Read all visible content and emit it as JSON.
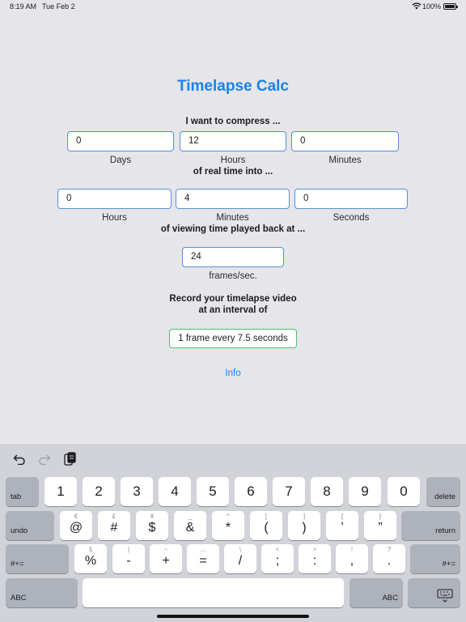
{
  "status_bar": {
    "time": "8:19 AM",
    "date": "Tue Feb 2",
    "battery_percent": "100%",
    "battery_level": 1.0
  },
  "app": {
    "title": "Timelapse Calc",
    "compress_heading": "I want to compress ...",
    "real_time": {
      "days": "0",
      "hours": "12",
      "minutes": "0",
      "days_label": "Days",
      "hours_label": "Hours",
      "minutes_label": "Minutes"
    },
    "into_heading": "of real time into ...",
    "viewing_time": {
      "hours": "0",
      "minutes": "4",
      "seconds": "0",
      "hours_label": "Hours",
      "minutes_label": "Minutes",
      "seconds_label": "Seconds"
    },
    "playback_heading": "of viewing time played back at ...",
    "frame_rate": {
      "value": "24",
      "unit_label": "frames/sec."
    },
    "record_heading_line1": "Record your timelapse video",
    "record_heading_line2": "at an interval of",
    "result": "1 frame every 7.5 seconds",
    "info_link": "Info"
  },
  "keyboard": {
    "toolbar": [
      "undo-icon",
      "redo-icon",
      "paste-icon"
    ],
    "row1": {
      "tab": "tab",
      "keys": [
        "1",
        "2",
        "3",
        "4",
        "5",
        "6",
        "7",
        "8",
        "9",
        "0"
      ],
      "delete": "delete"
    },
    "row2": {
      "undo": "undo",
      "keys": [
        {
          "main": "@",
          "alt": "€"
        },
        {
          "main": "#",
          "alt": "£"
        },
        {
          "main": "$",
          "alt": "¥"
        },
        {
          "main": "&",
          "alt": "_"
        },
        {
          "main": "*",
          "alt": "^"
        },
        {
          "main": "(",
          "alt": "["
        },
        {
          "main": ")",
          "alt": "]"
        },
        {
          "main": "’",
          "alt": "{"
        },
        {
          "main": "”",
          "alt": "}"
        }
      ],
      "return": "return"
    },
    "row3": {
      "symbols_left": "#+=",
      "keys": [
        {
          "main": "%",
          "alt": "§"
        },
        {
          "main": "-",
          "alt": "|"
        },
        {
          "main": "+",
          "alt": "~"
        },
        {
          "main": "=",
          "alt": "…"
        },
        {
          "main": "/",
          "alt": "\\"
        },
        {
          "main": ";",
          "alt": "<"
        },
        {
          "main": ":",
          "alt": ">"
        },
        {
          "main": ",",
          "alt": "!"
        },
        {
          "main": ".",
          "alt": "?"
        }
      ],
      "symbols_right": "#+="
    },
    "row4": {
      "abc_left": "ABC",
      "abc_right": "ABC"
    }
  }
}
